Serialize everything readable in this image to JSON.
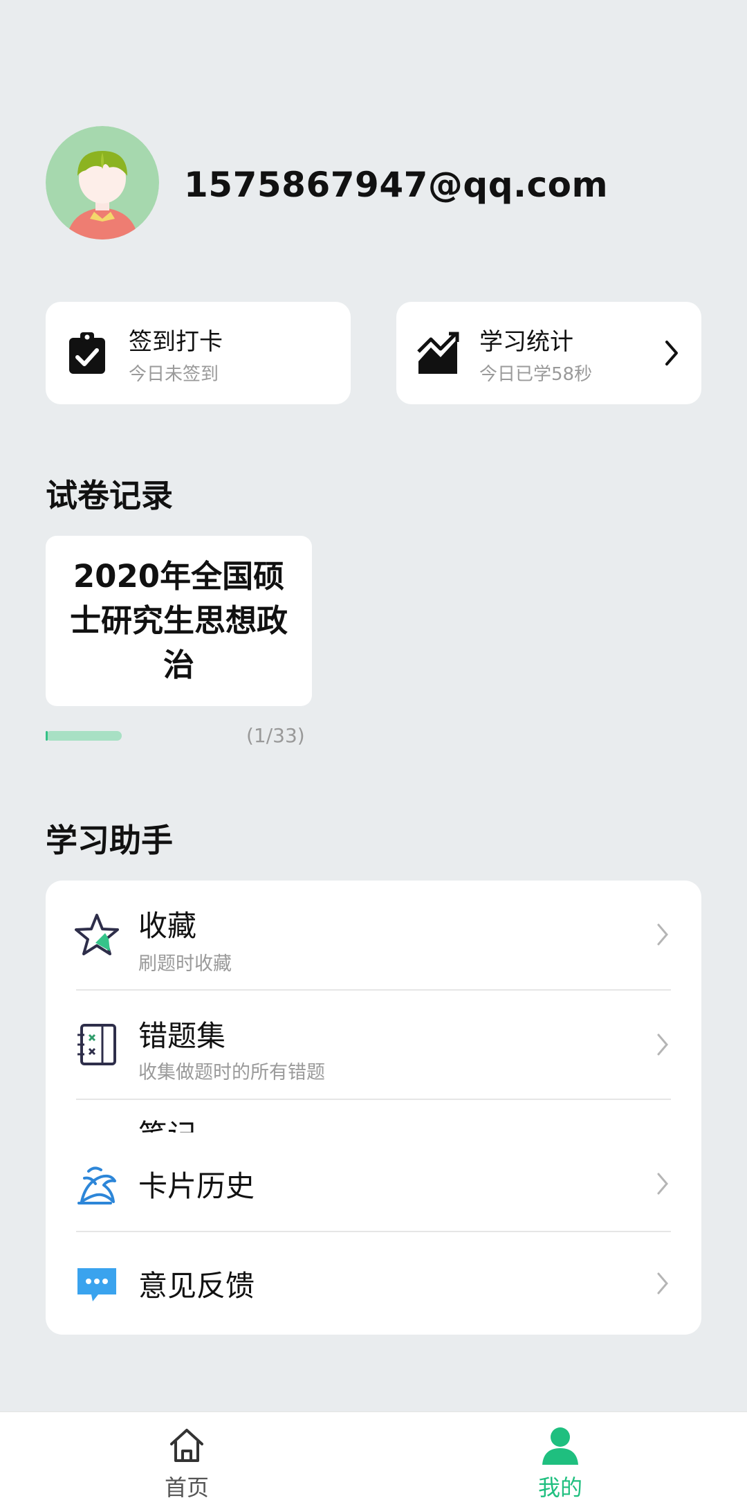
{
  "profile": {
    "email": "1575867947@qq.com",
    "avatar_icon": "user-avatar"
  },
  "quick_cards": {
    "checkin": {
      "title": "签到打卡",
      "subtitle": "今日未签到",
      "icon": "clipboard-check-icon"
    },
    "stats": {
      "title": "学习统计",
      "subtitle": "今日已学58秒",
      "icon": "trend-chart-icon"
    }
  },
  "records": {
    "section_title": "试卷记录",
    "paper": {
      "title": "2020年全国硕士研究生思想政治",
      "progress_text": "(1/33)",
      "progress_fraction": 0.03
    }
  },
  "helper": {
    "section_title": "学习助手",
    "items": [
      {
        "title": "收藏",
        "subtitle": "刷题时收藏",
        "icon": "star-icon"
      },
      {
        "title": "错题集",
        "subtitle": "收集做题时的所有错题",
        "icon": "wrong-book-icon"
      },
      {
        "title": "笔记",
        "icon": "note-icon"
      },
      {
        "title": "卡片历史",
        "icon": "card-history-icon"
      },
      {
        "title": "意见反馈",
        "icon": "feedback-icon"
      }
    ]
  },
  "nav": {
    "home": "首页",
    "me": "我的",
    "active": "me",
    "accent": "#1fbf7f"
  },
  "colors": {
    "background": "#e9ecee",
    "accent": "#1fbf7f",
    "progress_track": "#a8e0c4"
  }
}
